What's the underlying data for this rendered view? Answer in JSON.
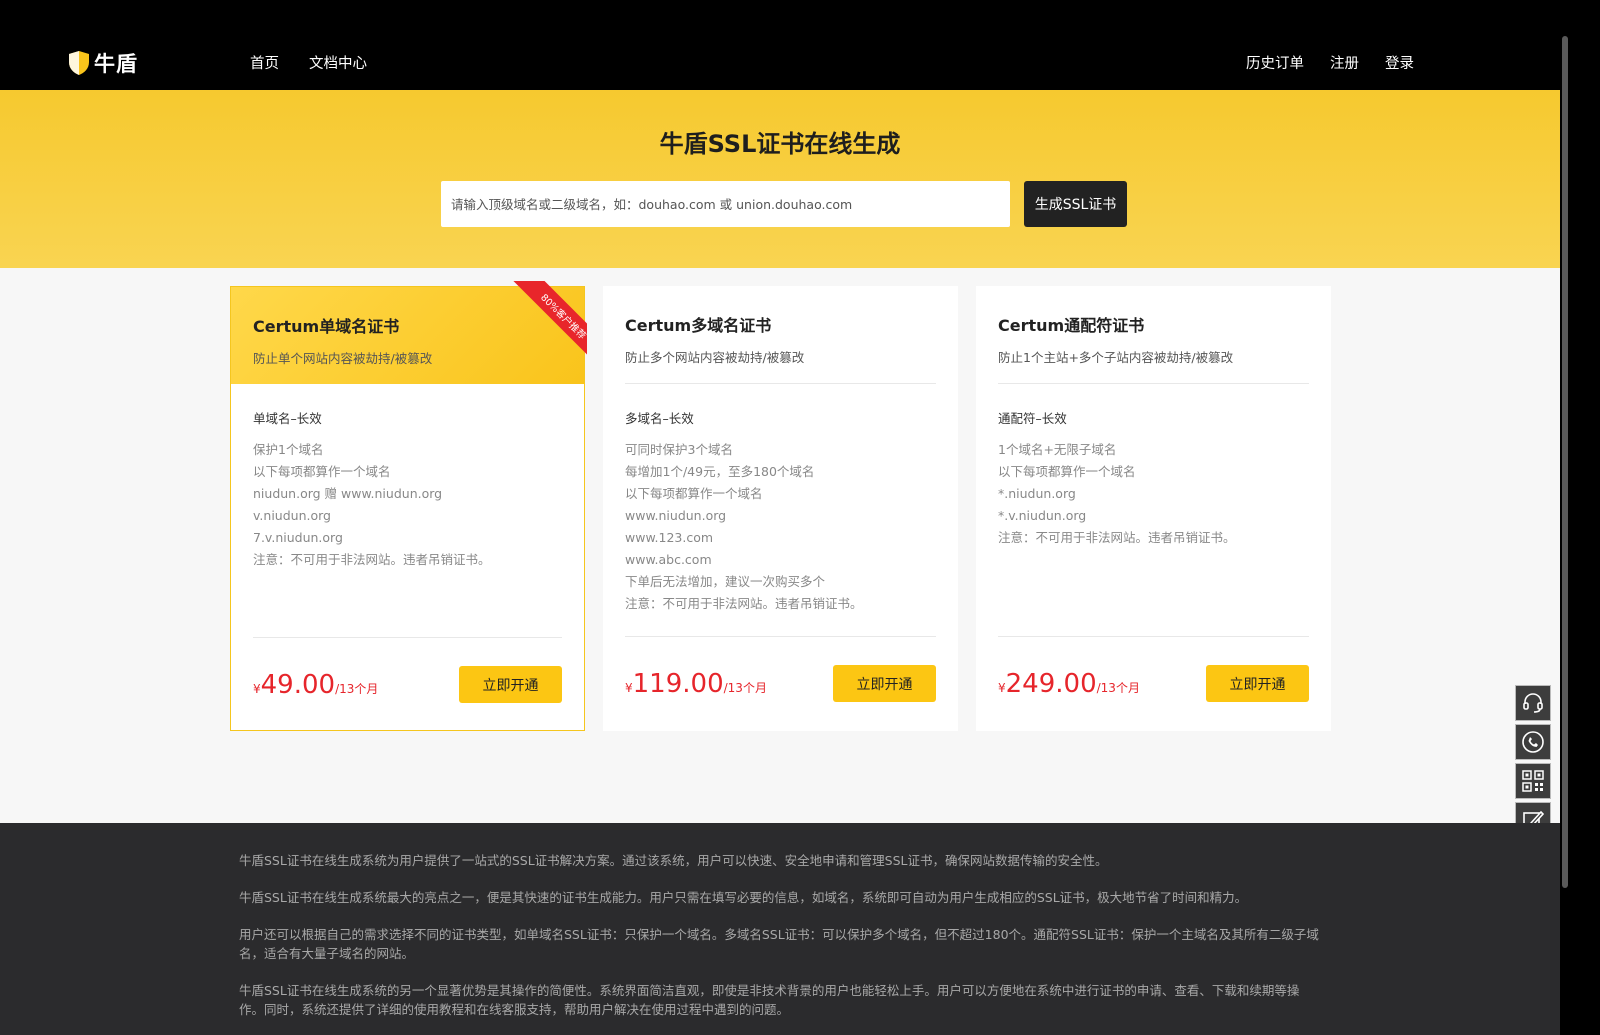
{
  "header": {
    "logo_text": "牛盾",
    "nav_left": [
      "首页",
      "文档中心"
    ],
    "nav_right": [
      "历史订单",
      "注册",
      "登录"
    ]
  },
  "hero": {
    "title": "牛盾SSL证书在线生成",
    "search_placeholder": "请输入顶级域名或二级域名，如：douhao.com 或 union.douhao.com",
    "generate_label": "生成SSL证书"
  },
  "cards": [
    {
      "title": "Certum单域名证书",
      "subtitle": "防止单个网站内容被劫持/被篡改",
      "ribbon": "80%客户推荐",
      "plan": "单域名–长效",
      "features": [
        "保护1个域名",
        "以下每项都算作一个域名",
        "niudun.org 赠 www.niudun.org",
        "v.niudun.org",
        "7.v.niudun.org",
        "注意：不可用于非法网站。违者吊销证书。"
      ],
      "currency": "¥",
      "price": "49.00",
      "period": "/13个月",
      "button": "立即开通"
    },
    {
      "title": "Certum多域名证书",
      "subtitle": "防止多个网站内容被劫持/被篡改",
      "plan": "多域名–长效",
      "features": [
        "可同时保护3个域名",
        "每增加1个/49元，至多180个域名",
        "以下每项都算作一个域名",
        "www.niudun.org",
        "www.123.com",
        "www.abc.com",
        "下单后无法增加，建议一次购买多个",
        "注意：不可用于非法网站。违者吊销证书。"
      ],
      "currency": "¥",
      "price": "119.00",
      "period": "/13个月",
      "button": "立即开通"
    },
    {
      "title": "Certum通配符证书",
      "subtitle": "防止1个主站+多个子站内容被劫持/被篡改",
      "plan": "通配符–长效",
      "features": [
        "1个域名+无限子域名",
        "以下每项都算作一个域名",
        "*.niudun.org",
        "*.v.niudun.org",
        "注意：不可用于非法网站。违者吊销证书。"
      ],
      "currency": "¥",
      "price": "249.00",
      "period": "/13个月",
      "button": "立即开通"
    }
  ],
  "side_tools": [
    "headset-icon",
    "phone-icon",
    "qrcode-icon",
    "edit-icon"
  ],
  "footer": {
    "paragraphs": [
      "牛盾SSL证书在线生成系统为用户提供了一站式的SSL证书解决方案。通过该系统，用户可以快速、安全地申请和管理SSL证书，确保网站数据传输的安全性。",
      "牛盾SSL证书在线生成系统最大的亮点之一，便是其快速的证书生成能力。用户只需在填写必要的信息，如域名，系统即可自动为用户生成相应的SSL证书，极大地节省了时间和精力。",
      "用户还可以根据自己的需求选择不同的证书类型，如单域名SSL证书：只保护一个域名。多域名SSL证书：可以保护多个域名，但不超过180个。通配符SSL证书：保护一个主域名及其所有二级子域名，适合有大量子域名的网站。",
      "牛盾SSL证书在线生成系统的另一个显著优势是其操作的简便性。系统界面简洁直观，即使是非技术背景的用户也能轻松上手。用户可以方便地在系统中进行证书的申请、查看、下载和续期等操作。同时，系统还提供了详细的使用教程和在线客服支持，帮助用户解决在使用过程中遇到的问题。"
    ]
  },
  "colors": {
    "brand_yellow": "#f9c41b",
    "price_red": "#e6252b",
    "header_black": "#000000",
    "footer_dark": "#2b2b2d"
  }
}
